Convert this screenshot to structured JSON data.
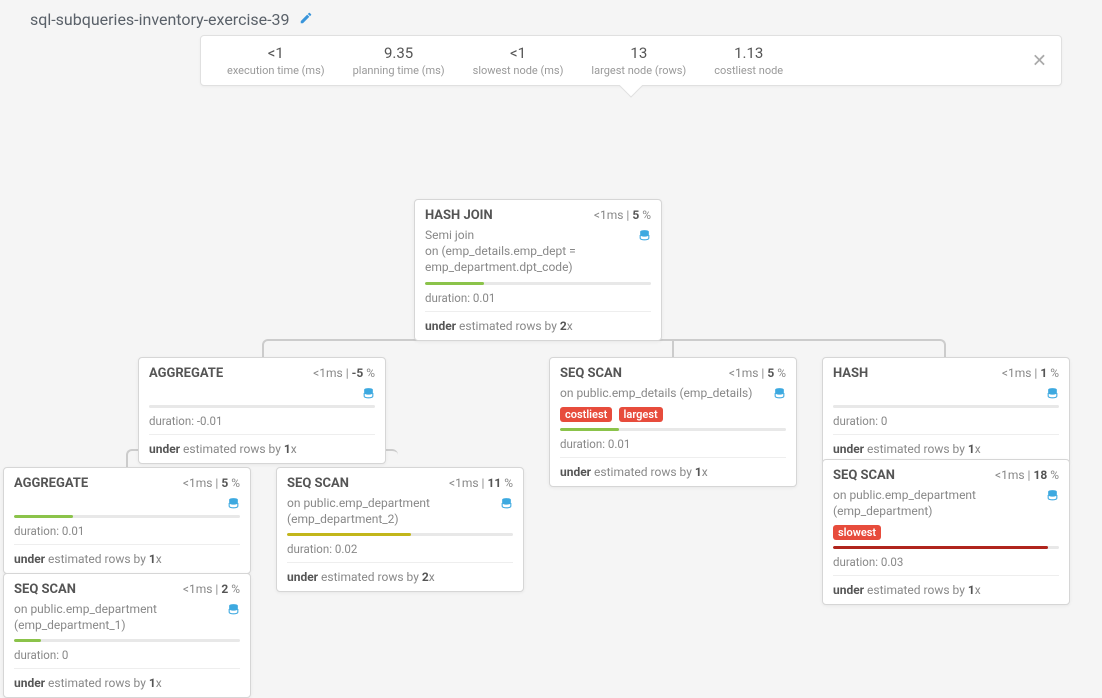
{
  "header": {
    "title": "sql-subqueries-inventory-exercise-39"
  },
  "stats": [
    {
      "value": "<1",
      "label": "execution time (ms)"
    },
    {
      "value": "9.35",
      "label": "planning time (ms)"
    },
    {
      "value": "<1",
      "label": "slowest node (ms)"
    },
    {
      "value": "13",
      "label": "largest node (rows)"
    },
    {
      "value": "1.13",
      "label": "costliest node"
    }
  ],
  "nodes": {
    "hashjoin": {
      "title": "HASH JOIN",
      "ms": "<1",
      "pct": "5",
      "detail_pre": "Semi ",
      "detail_mid": "join",
      "detail_post": "on (emp_details.emp_dept = emp_department.dpt_code)",
      "duration": "duration: 0.01",
      "est_pre": "under",
      "est_mid": " estimated rows by ",
      "est_fac": "2",
      "est_suf": "x"
    },
    "agg1": {
      "title": "AGGREGATE",
      "ms": "<1",
      "pct": "-5",
      "duration": "duration: -0.01",
      "est_pre": "under",
      "est_mid": " estimated rows by ",
      "est_fac": "1",
      "est_suf": "x"
    },
    "agg2": {
      "title": "AGGREGATE",
      "ms": "<1",
      "pct": "5",
      "duration": "duration: 0.01",
      "est_pre": "under",
      "est_mid": " estimated rows by ",
      "est_fac": "1",
      "est_suf": "x"
    },
    "seq_dept2": {
      "title": "SEQ SCAN",
      "ms": "<1",
      "pct": "11",
      "detail": "on public.emp_department (emp_department_2)",
      "duration": "duration: 0.02",
      "est_pre": "under",
      "est_mid": " estimated rows by ",
      "est_fac": "2",
      "est_suf": "x"
    },
    "seq_dept1": {
      "title": "SEQ SCAN",
      "ms": "<1",
      "pct": "2",
      "detail": "on public.emp_department (emp_department_1)",
      "duration": "duration: 0",
      "est_pre": "under",
      "est_mid": " estimated rows by ",
      "est_fac": "1",
      "est_suf": "x"
    },
    "seq_details": {
      "title": "SEQ SCAN",
      "ms": "<1",
      "pct": "5",
      "detail": "on public.emp_details (emp_details)",
      "tag1": "costliest",
      "tag2": "largest",
      "duration": "duration: 0.01",
      "est_pre": "under",
      "est_mid": " estimated rows by ",
      "est_fac": "1",
      "est_suf": "x"
    },
    "hash": {
      "title": "HASH",
      "ms": "<1",
      "pct": "1",
      "duration": "duration: 0",
      "est_pre": "under",
      "est_mid": " estimated rows by ",
      "est_fac": "1",
      "est_suf": "x"
    },
    "seq_dept": {
      "title": "SEQ SCAN",
      "ms": "<1",
      "pct": "18",
      "detail": "on public.emp_department (emp_department)",
      "tag1": "slowest",
      "duration": "duration: 0.03",
      "est_pre": "under",
      "est_mid": " estimated rows by ",
      "est_fac": "1",
      "est_suf": "x"
    }
  }
}
